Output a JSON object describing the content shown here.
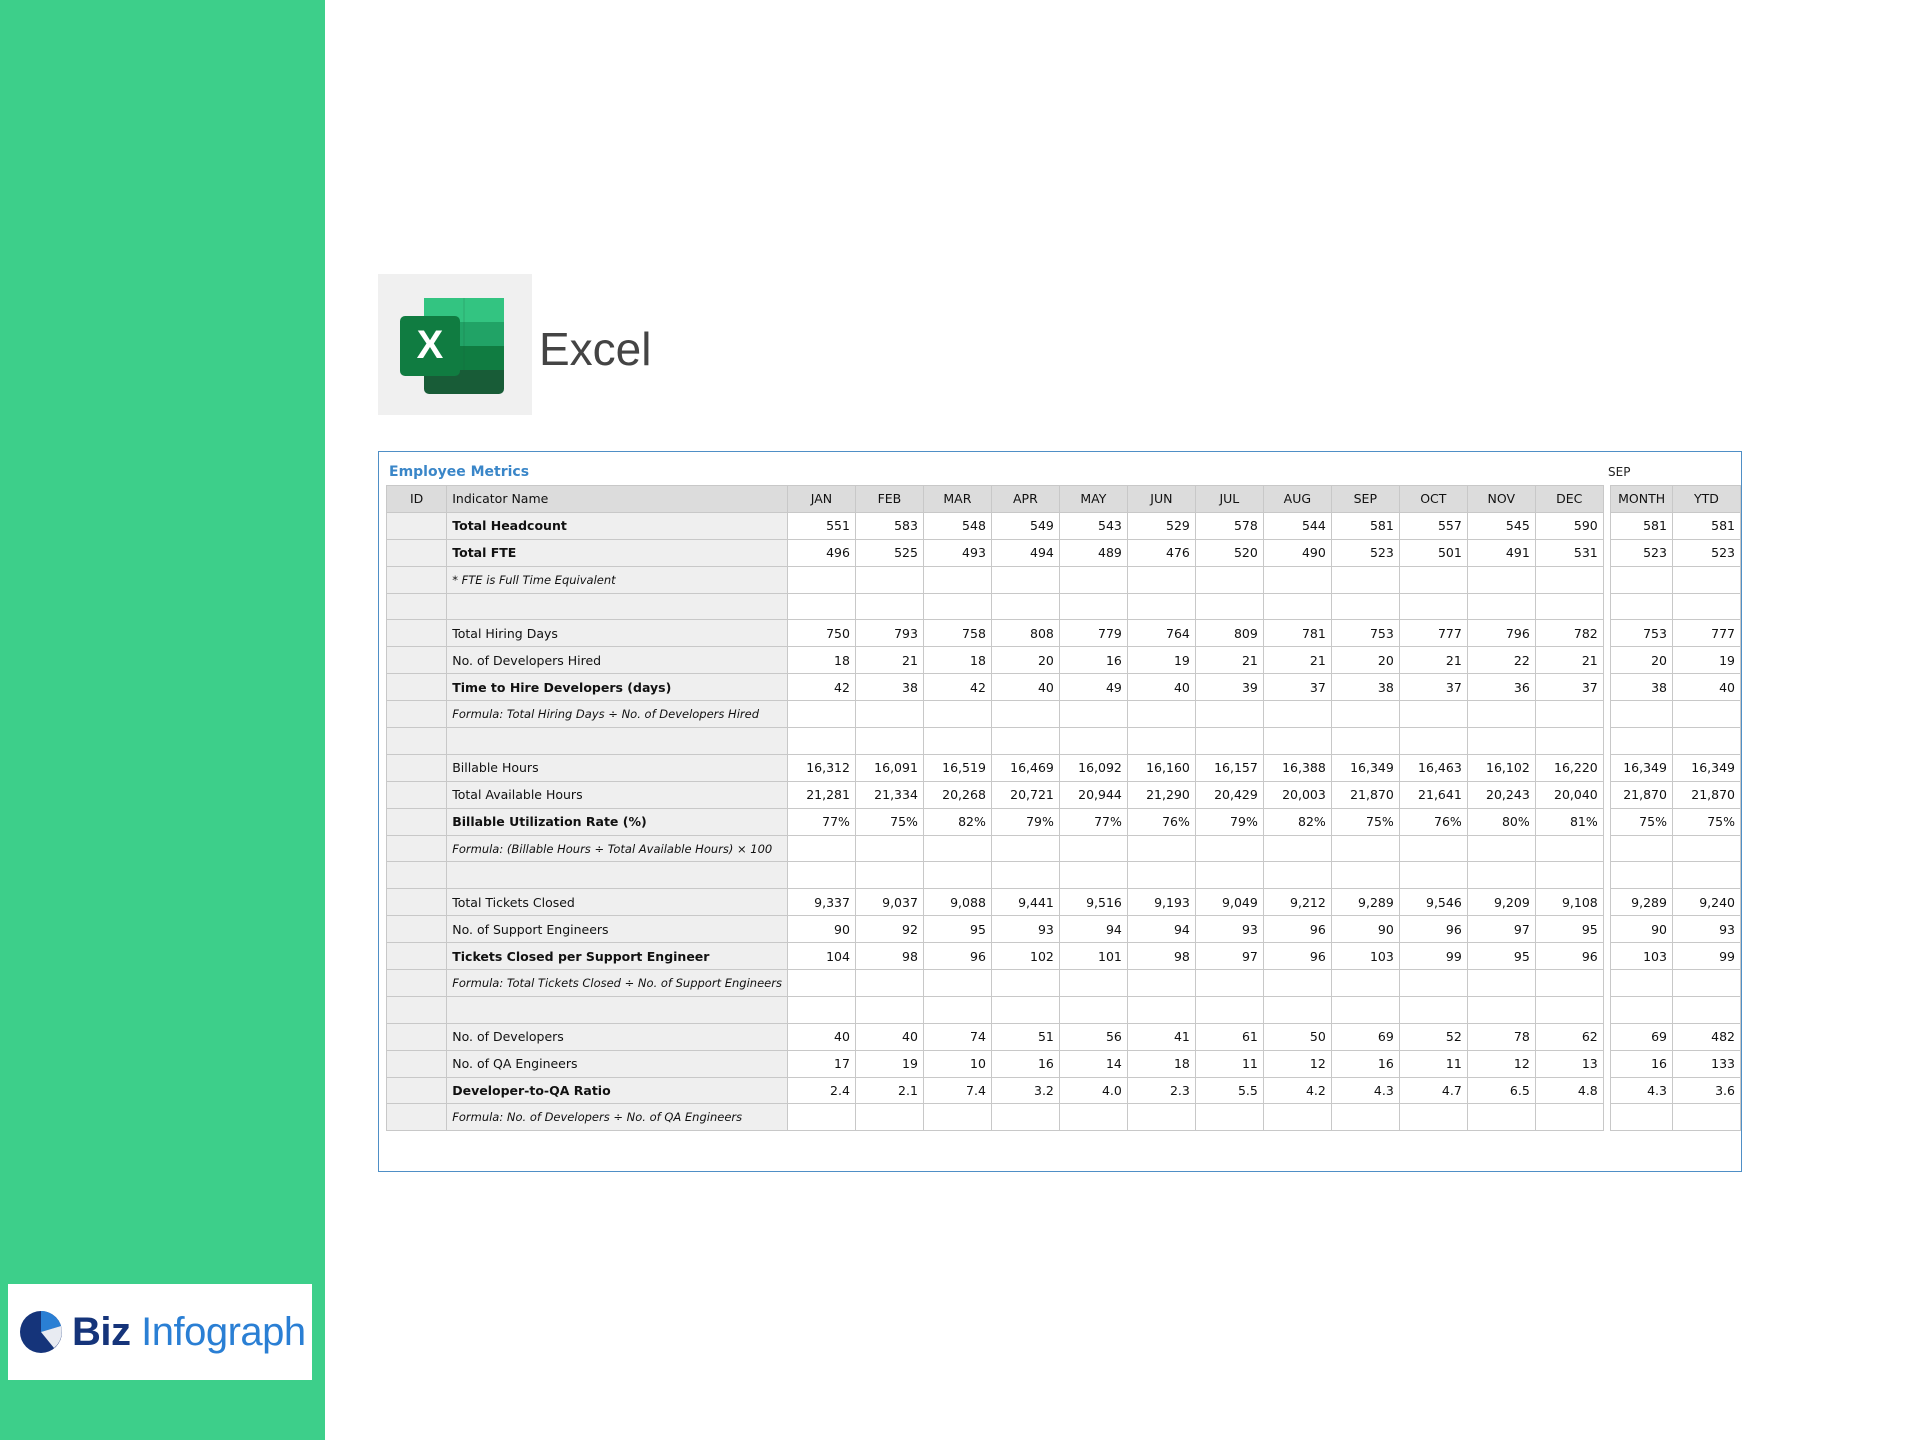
{
  "brand": {
    "word1": "Biz",
    "word2": "Infograph"
  },
  "app": {
    "name": "Excel",
    "icon": "excel-logo-icon"
  },
  "sheet": {
    "title": "Employee Metrics",
    "selected_month": "SEP",
    "headers": {
      "id": "ID",
      "name": "Indicator Name",
      "months": [
        "JAN",
        "FEB",
        "MAR",
        "APR",
        "MAY",
        "JUN",
        "JUL",
        "AUG",
        "SEP",
        "OCT",
        "NOV",
        "DEC"
      ],
      "summary": [
        "MONTH",
        "YTD"
      ]
    },
    "rows": [
      {
        "name": "Total Headcount",
        "style": "bold",
        "values": [
          "551",
          "583",
          "548",
          "549",
          "543",
          "529",
          "578",
          "544",
          "581",
          "557",
          "545",
          "590"
        ],
        "summary": [
          "581",
          "581"
        ]
      },
      {
        "name": "Total FTE",
        "style": "bold",
        "values": [
          "496",
          "525",
          "493",
          "494",
          "489",
          "476",
          "520",
          "490",
          "523",
          "501",
          "491",
          "531"
        ],
        "summary": [
          "523",
          "523"
        ]
      },
      {
        "name": "* FTE is Full Time Equivalent",
        "style": "note",
        "values": [],
        "summary": []
      },
      {
        "name": "",
        "style": "blank",
        "values": [],
        "summary": []
      },
      {
        "name": "Total Hiring Days",
        "style": "",
        "values": [
          "750",
          "793",
          "758",
          "808",
          "779",
          "764",
          "809",
          "781",
          "753",
          "777",
          "796",
          "782"
        ],
        "summary": [
          "753",
          "777"
        ]
      },
      {
        "name": "No. of Developers Hired",
        "style": "",
        "values": [
          "18",
          "21",
          "18",
          "20",
          "16",
          "19",
          "21",
          "21",
          "20",
          "21",
          "22",
          "21"
        ],
        "summary": [
          "20",
          "19"
        ]
      },
      {
        "name": "Time to Hire Developers (days)",
        "style": "bold",
        "values": [
          "42",
          "38",
          "42",
          "40",
          "49",
          "40",
          "39",
          "37",
          "38",
          "37",
          "36",
          "37"
        ],
        "summary": [
          "38",
          "40"
        ]
      },
      {
        "name": "Formula: Total Hiring Days ÷ No. of Developers Hired",
        "style": "note",
        "values": [],
        "summary": []
      },
      {
        "name": "",
        "style": "blank",
        "values": [],
        "summary": []
      },
      {
        "name": "Billable Hours",
        "style": "",
        "values": [
          "16,312",
          "16,091",
          "16,519",
          "16,469",
          "16,092",
          "16,160",
          "16,157",
          "16,388",
          "16,349",
          "16,463",
          "16,102",
          "16,220"
        ],
        "summary": [
          "16,349",
          "16,349"
        ]
      },
      {
        "name": "Total Available Hours",
        "style": "",
        "values": [
          "21,281",
          "21,334",
          "20,268",
          "20,721",
          "20,944",
          "21,290",
          "20,429",
          "20,003",
          "21,870",
          "21,641",
          "20,243",
          "20,040"
        ],
        "summary": [
          "21,870",
          "21,870"
        ]
      },
      {
        "name": "Billable Utilization Rate (%)",
        "style": "bold",
        "values": [
          "77%",
          "75%",
          "82%",
          "79%",
          "77%",
          "76%",
          "79%",
          "82%",
          "75%",
          "76%",
          "80%",
          "81%"
        ],
        "summary": [
          "75%",
          "75%"
        ]
      },
      {
        "name": "Formula: (Billable Hours ÷ Total Available Hours) × 100",
        "style": "note",
        "values": [],
        "summary": []
      },
      {
        "name": "",
        "style": "blank",
        "values": [],
        "summary": []
      },
      {
        "name": "Total Tickets Closed",
        "style": "",
        "values": [
          "9,337",
          "9,037",
          "9,088",
          "9,441",
          "9,516",
          "9,193",
          "9,049",
          "9,212",
          "9,289",
          "9,546",
          "9,209",
          "9,108"
        ],
        "summary": [
          "9,289",
          "9,240"
        ]
      },
      {
        "name": "No. of Support Engineers",
        "style": "",
        "values": [
          "90",
          "92",
          "95",
          "93",
          "94",
          "94",
          "93",
          "96",
          "90",
          "96",
          "97",
          "95"
        ],
        "summary": [
          "90",
          "93"
        ]
      },
      {
        "name": "Tickets Closed per Support Engineer",
        "style": "bold",
        "values": [
          "104",
          "98",
          "96",
          "102",
          "101",
          "98",
          "97",
          "96",
          "103",
          "99",
          "95",
          "96"
        ],
        "summary": [
          "103",
          "99"
        ]
      },
      {
        "name": "Formula: Total Tickets Closed ÷ No. of Support Engineers",
        "style": "note",
        "values": [],
        "summary": []
      },
      {
        "name": "",
        "style": "blank",
        "values": [],
        "summary": []
      },
      {
        "name": "No. of Developers",
        "style": "",
        "values": [
          "40",
          "40",
          "74",
          "51",
          "56",
          "41",
          "61",
          "50",
          "69",
          "52",
          "78",
          "62"
        ],
        "summary": [
          "69",
          "482"
        ]
      },
      {
        "name": " No. of QA Engineers",
        "style": "",
        "values": [
          "17",
          "19",
          "10",
          "16",
          "14",
          "18",
          "11",
          "12",
          "16",
          "11",
          "12",
          "13"
        ],
        "summary": [
          "16",
          "133"
        ]
      },
      {
        "name": "Developer-to-QA Ratio",
        "style": "bold",
        "values": [
          "2.4",
          "2.1",
          "7.4",
          "3.2",
          "4.0",
          "2.3",
          "5.5",
          "4.2",
          "4.3",
          "4.7",
          "6.5",
          "4.8"
        ],
        "summary": [
          "4.3",
          "3.6"
        ]
      },
      {
        "name": "Formula: No. of Developers ÷ No. of QA Engineers",
        "style": "note",
        "values": [],
        "summary": []
      }
    ]
  }
}
